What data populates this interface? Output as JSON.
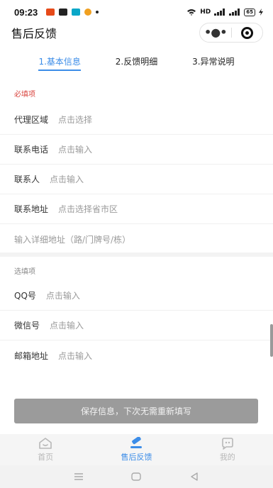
{
  "status_bar": {
    "time": "09:23",
    "network": "HD",
    "battery": "65"
  },
  "header": {
    "title": "售后反馈"
  },
  "tabs": [
    {
      "label": "1.基本信息",
      "active": true
    },
    {
      "label": "2.反馈明细",
      "active": false
    },
    {
      "label": "3.异常说明",
      "active": false
    }
  ],
  "required_section": {
    "label": "必填项",
    "rows": [
      {
        "label": "代理区域",
        "value": "点击选择"
      },
      {
        "label": "联系电话",
        "value": "点击输入"
      },
      {
        "label": "联系人",
        "value": "点击输入"
      },
      {
        "label": "联系地址",
        "value": "点击选择省市区"
      }
    ],
    "detail_address_placeholder": "输入详细地址（路/门牌号/栋）"
  },
  "optional_section": {
    "label": "选填项",
    "rows": [
      {
        "label": "QQ号",
        "value": "点击输入"
      },
      {
        "label": "微信号",
        "value": "点击输入"
      },
      {
        "label": "邮箱地址",
        "value": "点击输入"
      }
    ]
  },
  "save_button": "保存信息，下次无需重新填写",
  "tabbar": [
    {
      "label": "首页",
      "icon": "home-icon",
      "active": false
    },
    {
      "label": "售后反馈",
      "icon": "edit-icon",
      "active": true
    },
    {
      "label": "我的",
      "icon": "profile-icon",
      "active": false
    }
  ],
  "colors": {
    "accent": "#3c8de8",
    "required": "#d9453f",
    "button_disabled": "#9b9b9b"
  }
}
